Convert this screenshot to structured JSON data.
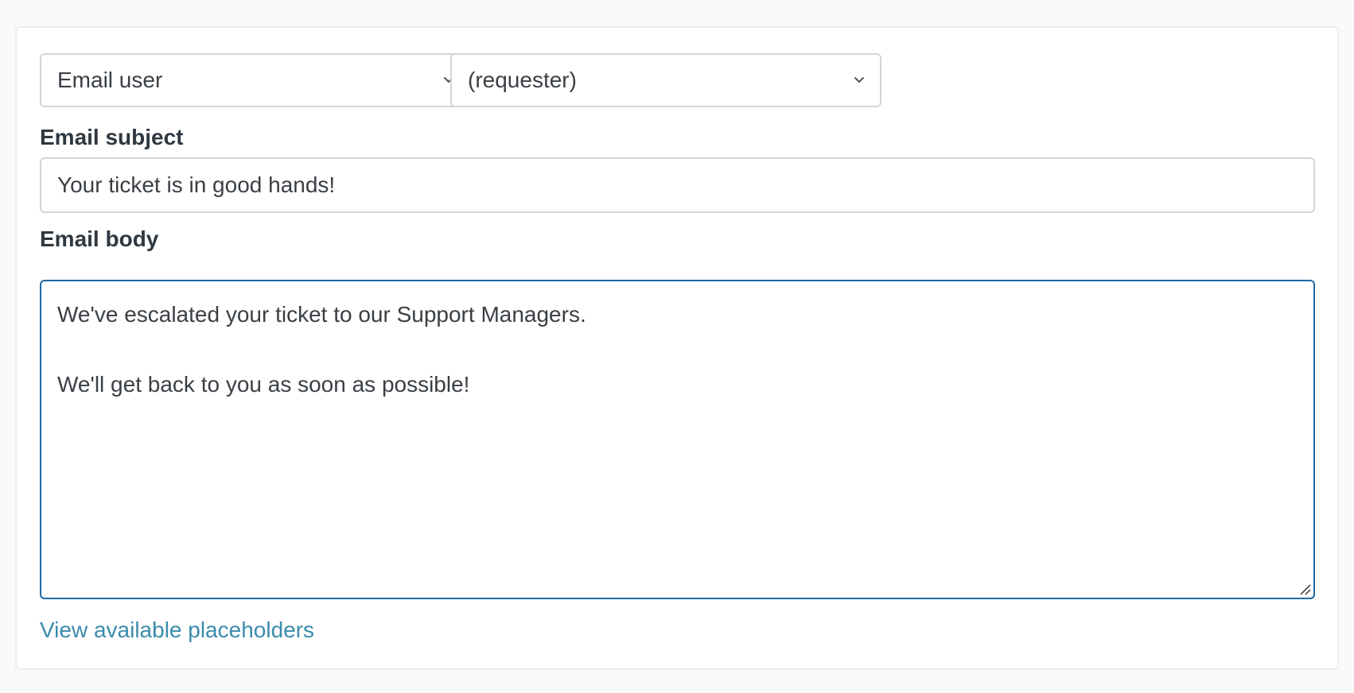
{
  "action": {
    "type_select": {
      "value": "Email user",
      "icon": "chevron-down-icon"
    },
    "recipient_select": {
      "value": "(requester)",
      "icon": "chevron-down-icon"
    }
  },
  "subject": {
    "label": "Email subject",
    "value": "Your ticket is in good hands!"
  },
  "body": {
    "label": "Email body",
    "lines": [
      "We've escalated your ticket to our Support Managers.",
      "",
      "We'll get back to you as soon as possible!"
    ]
  },
  "placeholders_link": "View available placeholders",
  "colors": {
    "focus_border": "#1d6aa6",
    "link": "#3b8bac"
  }
}
